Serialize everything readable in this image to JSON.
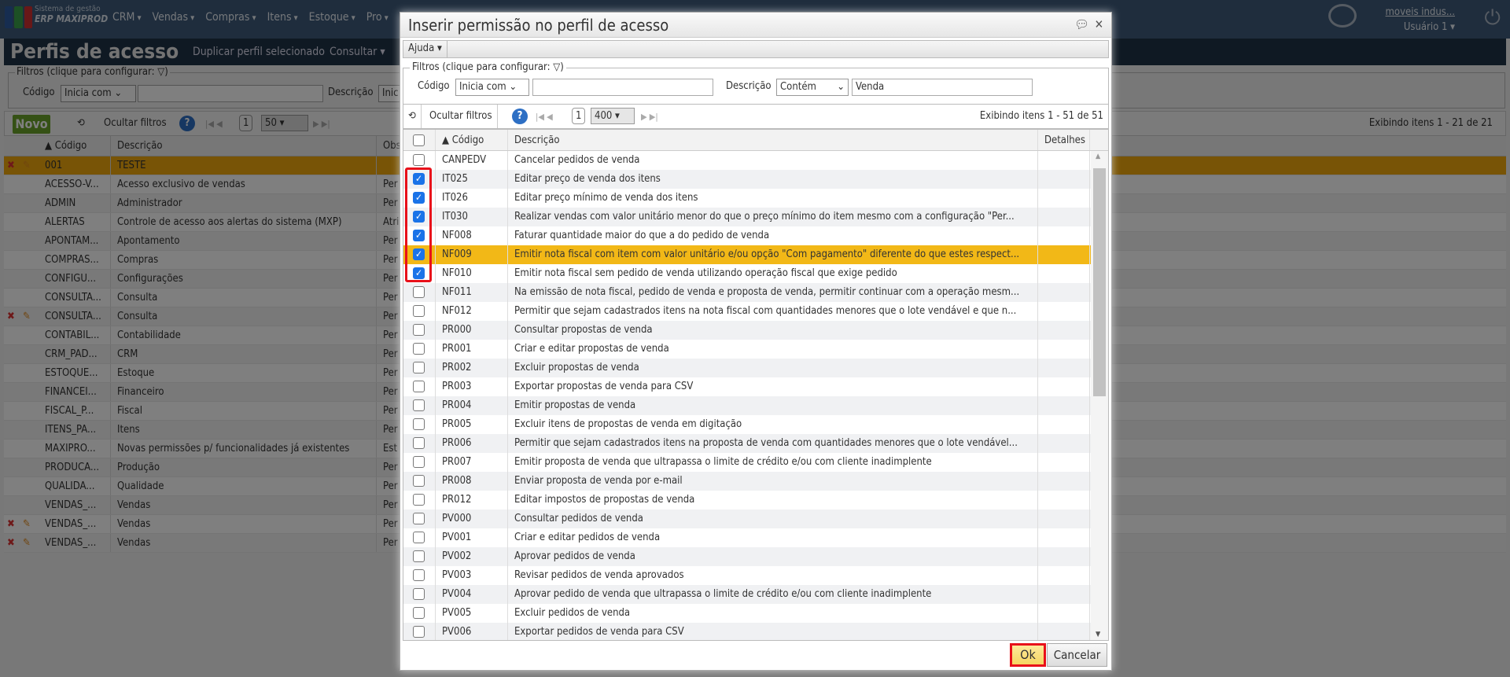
{
  "brand": {
    "line1": "Sistema de gestão",
    "line2": "ERP MAXIPROD"
  },
  "menu": [
    "CRM",
    "Vendas",
    "Compras",
    "Itens",
    "Estoque",
    "Pro"
  ],
  "user": {
    "company": "moveis indus...",
    "name": "Usuário 1 ▾"
  },
  "page": {
    "title": "Perfis de acesso",
    "actions": [
      "Duplicar perfil selecionado",
      "Consultar ▾"
    ]
  },
  "filters": {
    "legend": "Filtros (clique para configurar: ▽)",
    "codigo_label": "Código",
    "codigo_op": "Inicia com ⌄",
    "descricao_label": "Descrição",
    "descricao_op": "Inic"
  },
  "toolbar": {
    "novo": "Novo",
    "ocultar": "Ocultar filtros",
    "page": "1",
    "page_size": "50 ▾",
    "status": "Exibindo itens 1 - 21 de 21"
  },
  "grid": {
    "headers": [
      "▲ Código",
      "Descrição",
      "Obs"
    ],
    "rows": [
      {
        "code": "001",
        "desc": "TESTE",
        "obs": "",
        "actions": true,
        "selected": true
      },
      {
        "code": "ACESSO-V...",
        "desc": "Acesso exclusivo de vendas",
        "obs": "Per"
      },
      {
        "code": "ADMIN",
        "desc": "Administrador",
        "obs": "Per"
      },
      {
        "code": "ALERTAS",
        "desc": "Controle de acesso aos alertas do sistema (MXP)",
        "obs": "Atri"
      },
      {
        "code": "APONTAM...",
        "desc": "Apontamento",
        "obs": "Per"
      },
      {
        "code": "COMPRAS...",
        "desc": "Compras",
        "obs": "Per"
      },
      {
        "code": "CONFIGU...",
        "desc": "Configurações",
        "obs": "Per"
      },
      {
        "code": "CONSULTA...",
        "desc": "Consulta",
        "obs": "Per"
      },
      {
        "code": "CONSULTA...",
        "desc": "Consulta",
        "obs": "Per",
        "actions": true
      },
      {
        "code": "CONTABIL...",
        "desc": "Contabilidade",
        "obs": "Per"
      },
      {
        "code": "CRM_PAD...",
        "desc": "CRM",
        "obs": "Per"
      },
      {
        "code": "ESTOQUE...",
        "desc": "Estoque",
        "obs": "Per"
      },
      {
        "code": "FINANCEI...",
        "desc": "Financeiro",
        "obs": "Per"
      },
      {
        "code": "FISCAL_P...",
        "desc": "Fiscal",
        "obs": "Per"
      },
      {
        "code": "ITENS_PA...",
        "desc": "Itens",
        "obs": "Per"
      },
      {
        "code": "MAXIPRO...",
        "desc": "Novas permissões p/ funcionalidades já existentes",
        "obs": "Est"
      },
      {
        "code": "PRODUCA...",
        "desc": "Produção",
        "obs": "Per"
      },
      {
        "code": "QUALIDA...",
        "desc": "Qualidade",
        "obs": "Per"
      },
      {
        "code": "VENDAS_...",
        "desc": "Vendas",
        "obs": "Per"
      },
      {
        "code": "VENDAS_...",
        "desc": "Vendas",
        "obs": "Per",
        "actions": true
      },
      {
        "code": "VENDAS_...",
        "desc": "Vendas",
        "obs": "Per",
        "actions": true
      }
    ]
  },
  "dialog": {
    "title": "Inserir permissão no perfil de acesso",
    "menu": "Ajuda ▾",
    "filters": {
      "legend": "Filtros (clique para configurar: ▽)",
      "codigo_label": "Código",
      "codigo_op": "Inicia com ⌄",
      "codigo_value": "",
      "descricao_label": "Descrição",
      "descricao_op": "Contém",
      "descricao_value": "Venda"
    },
    "toolbar": {
      "ocultar": "Ocultar filtros",
      "help": "?",
      "page": "1",
      "page_size": "400 ▾",
      "status": "Exibindo itens 1 - 51 de 51"
    },
    "headers": [
      "▲ Código",
      "Descrição",
      "Detalhes"
    ],
    "rows": [
      {
        "code": "CANPEDV",
        "desc": "Cancelar pedidos de venda",
        "checked": false
      },
      {
        "code": "IT025",
        "desc": "Editar preço de venda dos itens",
        "checked": true
      },
      {
        "code": "IT026",
        "desc": "Editar preço mínimo de venda dos itens",
        "checked": true
      },
      {
        "code": "IT030",
        "desc": "Realizar vendas com valor unitário menor do que o preço mínimo do item mesmo com a configuração \"Per...",
        "checked": true
      },
      {
        "code": "NF008",
        "desc": "Faturar quantidade maior do que a do pedido de venda",
        "checked": true
      },
      {
        "code": "NF009",
        "desc": "Emitir nota fiscal com item com valor unitário e/ou opção \"Com pagamento\" diferente do que estes respect...",
        "checked": true,
        "highlight": true
      },
      {
        "code": "NF010",
        "desc": "Emitir nota fiscal sem pedido de venda utilizando operação fiscal que exige pedido",
        "checked": true
      },
      {
        "code": "NF011",
        "desc": "Na emissão de nota fiscal, pedido de venda e proposta de venda, permitir continuar com a operação mesm...",
        "checked": false
      },
      {
        "code": "NF012",
        "desc": "Permitir que sejam cadastrados itens na nota fiscal com quantidades menores que o lote vendável e que n...",
        "checked": false
      },
      {
        "code": "PR000",
        "desc": "Consultar propostas de venda",
        "checked": false
      },
      {
        "code": "PR001",
        "desc": "Criar e editar propostas de venda",
        "checked": false
      },
      {
        "code": "PR002",
        "desc": "Excluir propostas de venda",
        "checked": false
      },
      {
        "code": "PR003",
        "desc": "Exportar propostas de venda para CSV",
        "checked": false
      },
      {
        "code": "PR004",
        "desc": "Emitir propostas de venda",
        "checked": false
      },
      {
        "code": "PR005",
        "desc": "Excluir itens de propostas de venda em digitação",
        "checked": false
      },
      {
        "code": "PR006",
        "desc": "Permitir que sejam cadastrados itens na proposta de venda com quantidades menores que o lote vendável...",
        "checked": false
      },
      {
        "code": "PR007",
        "desc": "Emitir proposta de venda que ultrapassa o limite de crédito e/ou com cliente inadimplente",
        "checked": false
      },
      {
        "code": "PR008",
        "desc": "Enviar proposta de venda por e-mail",
        "checked": false
      },
      {
        "code": "PR012",
        "desc": "Editar impostos de propostas de venda",
        "checked": false
      },
      {
        "code": "PV000",
        "desc": "Consultar pedidos de venda",
        "checked": false
      },
      {
        "code": "PV001",
        "desc": "Criar e editar pedidos de venda",
        "checked": false
      },
      {
        "code": "PV002",
        "desc": "Aprovar pedidos de venda",
        "checked": false
      },
      {
        "code": "PV003",
        "desc": "Revisar pedidos de venda aprovados",
        "checked": false
      },
      {
        "code": "PV004",
        "desc": "Aprovar pedido de venda que ultrapassa o limite de crédito e/ou com cliente inadimplente",
        "checked": false
      },
      {
        "code": "PV005",
        "desc": "Excluir pedidos de venda",
        "checked": false
      },
      {
        "code": "PV006",
        "desc": "Exportar pedidos de venda para CSV",
        "checked": false
      }
    ],
    "ok": "Ok",
    "cancel": "Cancelar"
  },
  "colors": {
    "accent": "#f2b817",
    "novo": "#6aa22b",
    "highlight_border": "#e8101a",
    "checkbox": "#1a73e8"
  }
}
